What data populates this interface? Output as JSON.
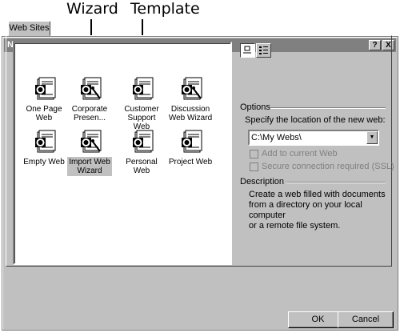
{
  "annotations": {
    "wizard": "Wizard",
    "template": "Template"
  },
  "dialog": {
    "title": "New",
    "help_button": "?",
    "close_button": "X"
  },
  "tab": {
    "label": "Web Sites"
  },
  "items": [
    {
      "label_lines": [
        "One Page",
        "Web"
      ],
      "icon": "web-page-icon"
    },
    {
      "label_lines": [
        "Corporate",
        "Presen..."
      ],
      "icon": "web-wizard-icon"
    },
    {
      "label_lines": [
        "Customer",
        "Support Web"
      ],
      "icon": "web-template-icon"
    },
    {
      "label_lines": [
        "Discussion",
        "Web Wizard"
      ],
      "icon": "web-wizard-icon"
    },
    {
      "label_lines": [
        "Empty Web"
      ],
      "icon": "web-template-icon"
    },
    {
      "label_lines": [
        "Import Web",
        "Wizard"
      ],
      "icon": "web-wizard-icon",
      "selected": true
    },
    {
      "label_lines": [
        "Personal Web"
      ],
      "icon": "web-template-icon"
    },
    {
      "label_lines": [
        "Project Web"
      ],
      "icon": "web-template-icon"
    }
  ],
  "options": {
    "title": "Options",
    "location_label": "Specify the location of the new web:",
    "location_value": "C:\\My Webs\\",
    "add_to_current": "Add to current Web",
    "secure_connection": "Secure connection required (SSL)"
  },
  "description": {
    "title": "Description",
    "lines": [
      "Create a web filled with documents",
      "from a directory on your local computer",
      "or a remote file system."
    ]
  },
  "buttons": {
    "ok": "OK",
    "cancel": "Cancel"
  },
  "colors": {
    "dialog_bg": "#c0c0c0",
    "titlebar": "#808080",
    "selection": "#c0c0c0"
  }
}
